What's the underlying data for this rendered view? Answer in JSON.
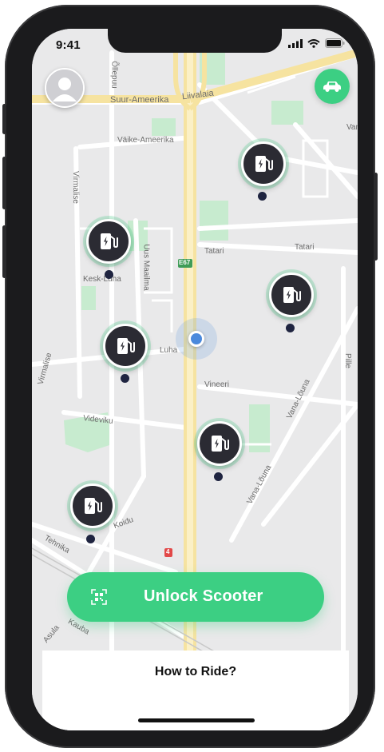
{
  "status_bar": {
    "time": "9:41"
  },
  "map": {
    "labels": {
      "suur_ameerika": "Suur-Ameerika",
      "liivalaia": "Liivalaia",
      "valke_ameerika": "Väike-Ameerika",
      "ollepuu": "Õllepuu",
      "virmalise_top": "Virmalise",
      "kesk_luha": "Kesk-Luha",
      "uus_maailma": "Uus Maailma",
      "e67": "E67",
      "tatari_left": "Tatari",
      "tatari_right": "Tatari",
      "luha": "Luha",
      "virmalise_bottom": "Virmalise",
      "vineeri": "Vineeri",
      "videviku": "Videviku",
      "vana_louna_right": "Vana-Lõuna",
      "vana_louna_mid": "Vana-Lõuna",
      "pille": "Pille",
      "koidu": "Koidu",
      "tehnika": "Tehnika",
      "road4": "4",
      "asula": "Asula",
      "kauba": "Kauba",
      "vana_top": "Vana"
    }
  },
  "actions": {
    "unlock_label": "Unlock Scooter",
    "how_to_ride_label": "How to Ride?"
  },
  "colors": {
    "accent": "#3ccf83",
    "pin_dark": "#2b2b33",
    "location_blue": "#4a89dc"
  },
  "icons": {
    "profile": "avatar-icon",
    "car": "car-icon",
    "station": "ev-charging-station-icon",
    "qr": "qr-code-icon"
  }
}
